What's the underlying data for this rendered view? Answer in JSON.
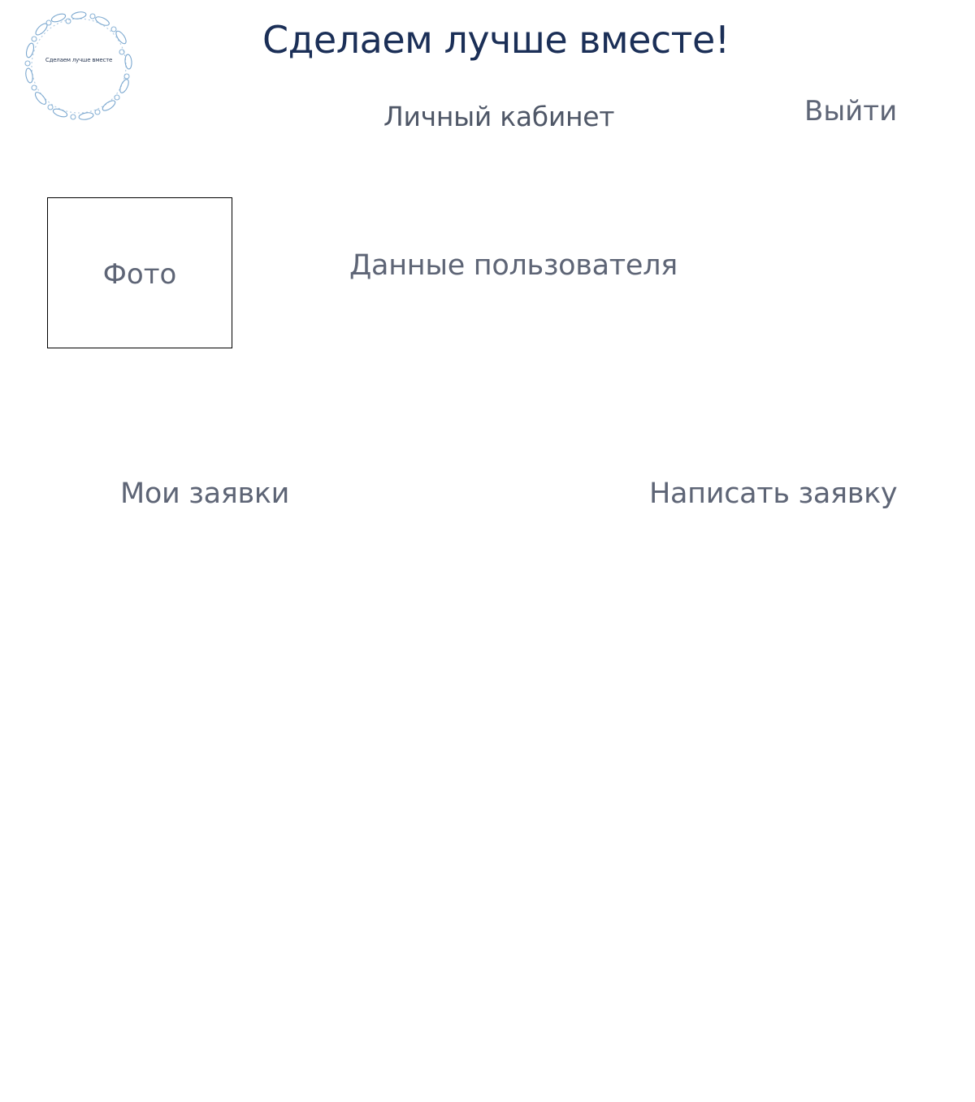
{
  "header": {
    "logo_text": "Сделаем лучше вместе",
    "site_title": "Сделаем лучше вместе!",
    "page_title": "Личный кабинет",
    "logout_label": "Выйти"
  },
  "profile": {
    "photo_label": "Фото",
    "user_data_label": "Данные пользователя"
  },
  "actions": {
    "my_requests_label": "Мои заявки",
    "write_request_label": "Написать заявку"
  },
  "colors": {
    "title": "#1b2f57",
    "text": "#5e6576",
    "logo_wreath": "#7aa7cf"
  }
}
